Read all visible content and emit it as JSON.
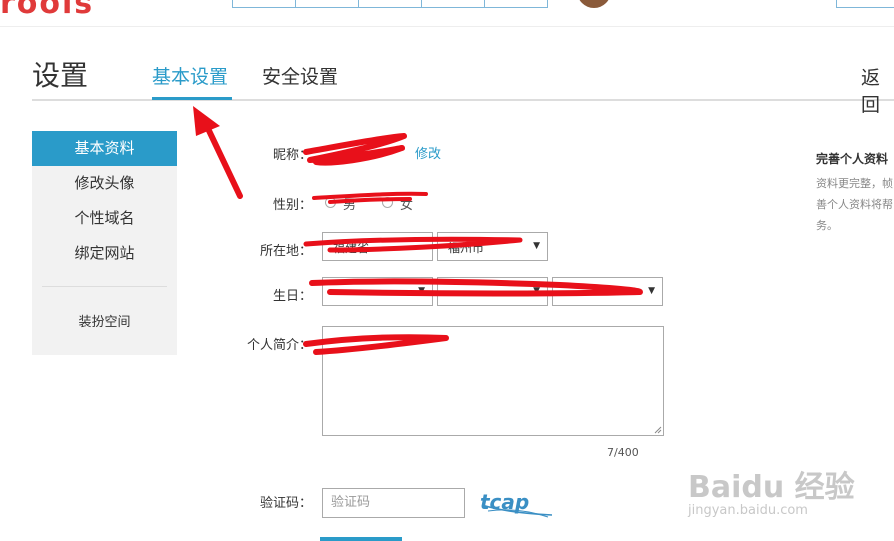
{
  "site": {
    "logo_text": "roois"
  },
  "header": {
    "title": "设置",
    "tabs": [
      {
        "label": "基本设置"
      },
      {
        "label": "安全设置"
      }
    ],
    "back_label": "返回"
  },
  "sidebar": {
    "items": [
      {
        "label": "基本资料"
      },
      {
        "label": "修改头像"
      },
      {
        "label": "个性域名"
      },
      {
        "label": "绑定网站"
      }
    ],
    "extra_item": "装扮空间"
  },
  "form": {
    "nickname_label": "昵称：",
    "nickname_edit": "修改",
    "gender_label": "性别：",
    "gender_options": [
      "男",
      "女"
    ],
    "location_label": "所在地：",
    "location_province": "福建省",
    "location_city": "福州市",
    "birthday_label": "生日：",
    "intro_label": "个人简介：",
    "intro_counter": "7/400",
    "captcha_label": "验证码：",
    "captcha_placeholder": "验证码",
    "captcha_text": "tcap"
  },
  "right_panel": {
    "title": "完善个人资料",
    "text": "资料更完整，帧 善个人资料将帮 务。"
  },
  "watermark": {
    "text": "Baidu 经验",
    "url": "jingyan.baidu.com"
  },
  "colors": {
    "accent": "#2a9bc9",
    "annotation_red": "#e8101a"
  }
}
